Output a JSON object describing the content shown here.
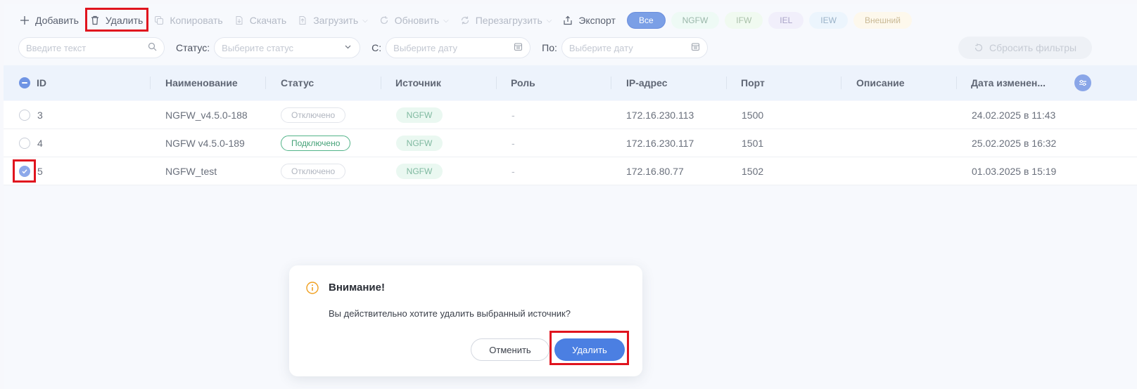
{
  "toolbar": {
    "add_label": "Добавить",
    "delete_label": "Удалить",
    "copy_label": "Копировать",
    "download_label": "Скачать",
    "upload_label": "Загрузить",
    "refresh_label": "Обновить",
    "restart_label": "Перезагрузить",
    "export_label": "Экспорт"
  },
  "source_chips": {
    "all": "Все",
    "ngfw": "NGFW",
    "ifw": "IFW",
    "iel": "IEL",
    "iew": "IEW",
    "external": "Внешний"
  },
  "filters": {
    "search_placeholder": "Введите текст",
    "status_label": "Статус:",
    "status_placeholder": "Выберите статус",
    "from_label": "С:",
    "from_placeholder": "Выберите дату",
    "to_label": "По:",
    "to_placeholder": "Выберите дату",
    "reset_label": "Сбросить фильтры"
  },
  "table": {
    "columns": [
      "ID",
      "Наименование",
      "Статус",
      "Источник",
      "Роль",
      "IP-адрес",
      "Порт",
      "Описание",
      "Дата изменен..."
    ],
    "rows": [
      {
        "id": "3",
        "name": "NGFW_v4.5.0-188",
        "status": "Отключено",
        "status_type": "off",
        "source": "NGFW",
        "role": "-",
        "ip": "172.16.230.113",
        "port": "1500",
        "description": "",
        "date": "24.02.2025 в 11:43",
        "checked": false
      },
      {
        "id": "4",
        "name": "NGFW v4.5.0-189",
        "status": "Подключено",
        "status_type": "on",
        "source": "NGFW",
        "role": "-",
        "ip": "172.16.230.117",
        "port": "1501",
        "description": "",
        "date": "25.02.2025 в 16:32",
        "checked": false
      },
      {
        "id": "5",
        "name": "NGFW_test",
        "status": "Отключено",
        "status_type": "off",
        "source": "NGFW",
        "role": "-",
        "ip": "172.16.80.77",
        "port": "1502",
        "description": "",
        "date": "01.03.2025 в 15:19",
        "checked": true
      }
    ]
  },
  "dialog": {
    "title": "Внимание!",
    "message": "Вы действительно хотите удалить выбранный источник?",
    "cancel_label": "Отменить",
    "confirm_label": "Удалить"
  },
  "colors": {
    "accent": "#4b7fe2",
    "highlight": "#e0141e",
    "connected": "#44a177",
    "warning": "#f0a020"
  }
}
